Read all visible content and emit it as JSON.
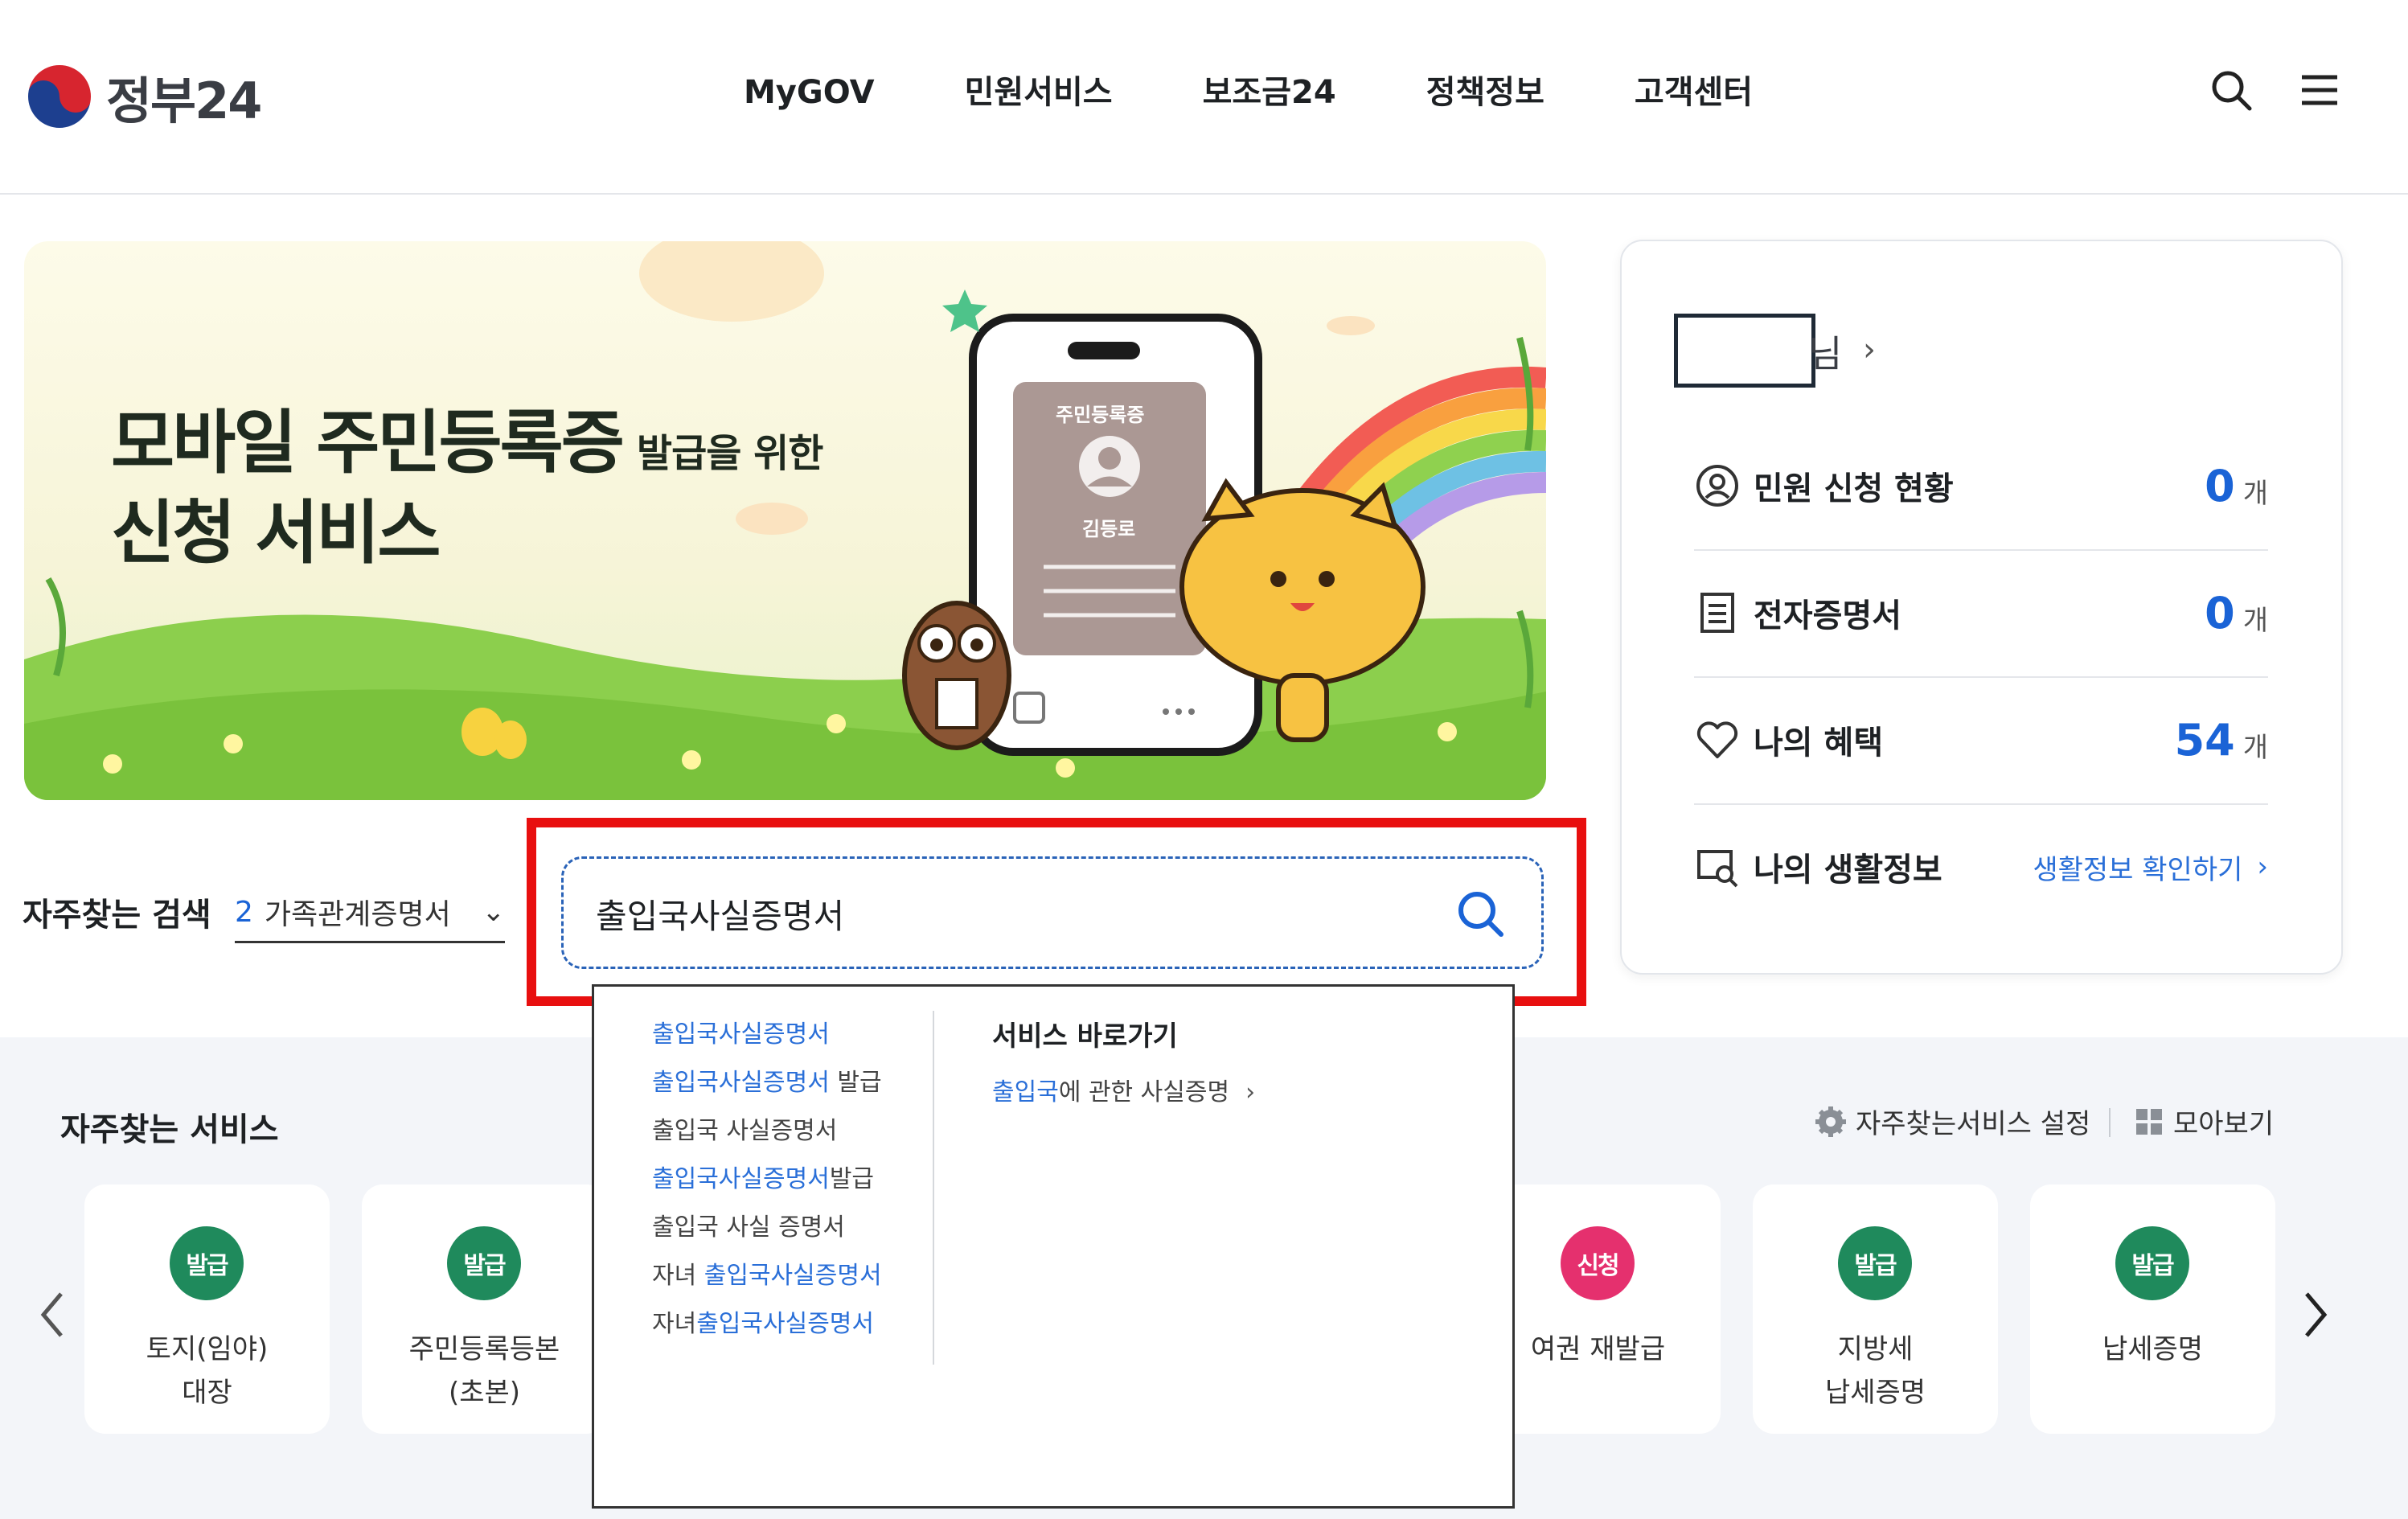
{
  "header": {
    "logo_text": "정부24",
    "nav": [
      "MyGOV",
      "민원서비스",
      "보조금24",
      "정책정보",
      "고객센터"
    ]
  },
  "banner": {
    "title_main": "모바일 주민등록증",
    "title_small": "발급을 위한",
    "title_line2": "신청 서비스",
    "card_title": "주민등록증",
    "card_name": "김등로"
  },
  "user_panel": {
    "name_suffix": "님",
    "rows": [
      {
        "icon": "user-circle-icon",
        "label": "민원 신청 현황",
        "count": "0",
        "unit": "개"
      },
      {
        "icon": "document-list-icon",
        "label": "전자증명서",
        "count": "0",
        "unit": "개"
      },
      {
        "icon": "heart-icon",
        "label": "나의 혜택",
        "count": "54",
        "unit": "개"
      },
      {
        "icon": "life-info-icon",
        "label": "나의 생활정보",
        "link": "생활정보 확인하기",
        "link_arrow": "›"
      }
    ]
  },
  "frequent_search": {
    "label": "자주찾는 검색",
    "rank": "2",
    "value": "가족관계증명서"
  },
  "search": {
    "value": "출입국사실증명서"
  },
  "autocomplete": {
    "items": [
      {
        "hl": "출입국사실증명서",
        "rest": ""
      },
      {
        "hl": "출입국사실증명서",
        "rest": " 발급"
      },
      {
        "pre": "출입국 사실증명서"
      },
      {
        "hl": "출입국사실증명서",
        "rest": "발급"
      },
      {
        "pre": "출입국 사실 증명서"
      },
      {
        "pre": "자녀 ",
        "hl": "출입국사실증명서"
      },
      {
        "pre": "자녀",
        "hl": "출입국사실증명서"
      }
    ],
    "right_title": "서비스 바로가기",
    "right_link_hl": "출입국",
    "right_link_rest": "에 관한 사실증명",
    "right_link_arrow": "›"
  },
  "services": {
    "title": "자주찾는 서비스",
    "setting": "자주찾는서비스 설정",
    "view_all": "모아보기",
    "cards": [
      {
        "badge": "발급",
        "color": "#1f8a5c",
        "label": "토지(임야)\n대장"
      },
      {
        "badge": "발급",
        "color": "#1f8a5c",
        "label": "주민등록등본\n(초본)"
      },
      {
        "badge": "신청",
        "color": "#e5306e",
        "label": "여권 재발급"
      },
      {
        "badge": "발급",
        "color": "#1f8a5c",
        "label": "지방세\n납세증명"
      },
      {
        "badge": "발급",
        "color": "#1f8a5c",
        "label": "납세증명"
      }
    ]
  }
}
